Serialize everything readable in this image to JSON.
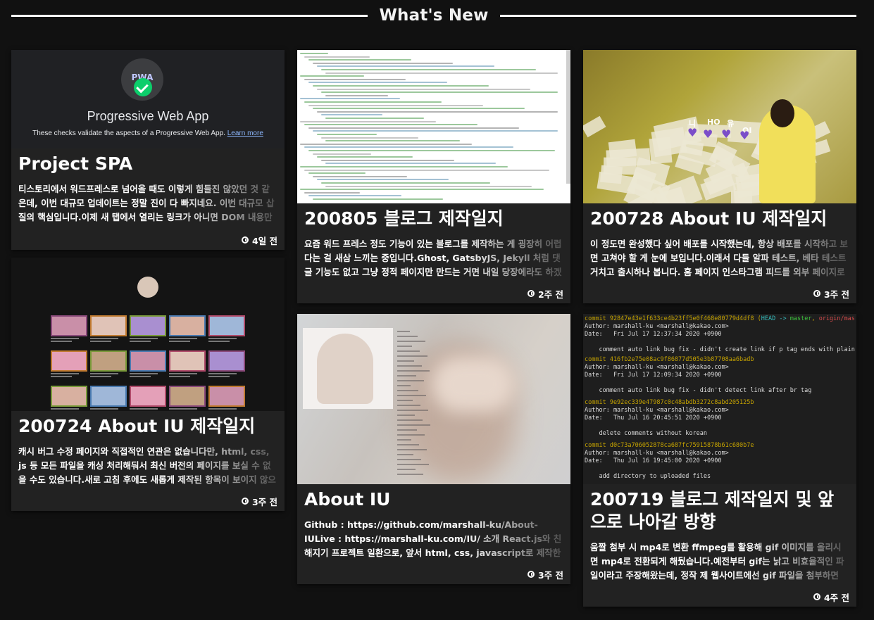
{
  "header": {
    "title": "What's New"
  },
  "posts": [
    {
      "title": "Project SPA",
      "excerpt": "티스토리에서 워드프레스로 넘어올 때도 이렇게 힘들진 않았던 것 같은데, 이번 대규모 업데이트는 정말 진이 다 빠지네요. 이번 대규모 삽질의 핵심입니다.이제 새 탭에서 열리는 링크가 아니면 DOM 내용만",
      "time": "4일 전",
      "thumb": {
        "badge": "PWA",
        "heading": "Progressive Web App",
        "desc": "These checks validate the aspects of a Progressive Web App.",
        "link": "Learn more"
      }
    },
    {
      "title": "200805 블로그 제작일지",
      "excerpt": "요즘 워드 프레스 정도 기능이 있는 블로그를 제작하는 게 굉장히 어렵다는 걸 새삼 느끼는 중입니다.Ghost, GatsbyJS, Jekyll 처럼 댓글 기능도 없고 그냥 정적 페이지만 만드는 거면 내일 당장에라도 하겠는데,",
      "time": "2주 전"
    },
    {
      "title": "200728 About IU 제작일지",
      "excerpt": "이 정도면 완성했다 싶어 배포를 시작했는데, 항상 배포를 시작하고 보면 고쳐야 할 게 눈에 보입니다.이래서 다들 알파 테스트, 베타 테스트 거치고 출시하나 봅니다. 홈 페이지 인스타그램 피드를 외부 페이지로",
      "time": "3주 전",
      "thumb": {
        "words": [
          "니",
          "HO",
          "유",
          "OI"
        ]
      }
    },
    {
      "title": "200724 About IU 제작일지",
      "excerpt": "캐시 버그 수정 페이지와 직접적인 연관은 없습니다만, html, css, js 등 모든 파일을 캐싱 처리해둬서 최신 버전의 페이지를 보실 수 없을 수도 있습니다.새로 고침 후에도 새롭게 제작된 항목이 보이지 않으신",
      "time": "3주 전"
    },
    {
      "title": "About IU",
      "excerpt": "Github : https://github.com/marshall-ku/About-IULive : https://marshall-ku.com/IU/ 소개 React.js와 친해지기 프로젝트 일환으로, 앞서 html, css, javascript로 제작한 트와이스 팬 페이지의 디자",
      "time": "3주 전"
    },
    {
      "title": "200719 블로그 제작일지 및 앞으로 나아갈 방향",
      "excerpt": "움짤 첨부 시 mp4로 변환 ffmpeg를 활용해 gif 이미지를 올리시면 mp4로 전환되게 해뒀습니다.예전부터 gif는 낡고 비효율적인 파일이라고 주장해왔는데, 정작 제 웹사이트에선 gif 파일을 첨부하면 gif 그",
      "time": "4주 전",
      "thumb": {
        "commits": [
          {
            "hash": "commit 92847e43e1f633ce4b23ff5e0f468e80779d4df8",
            "refs_open": " (",
            "head": "HEAD -> ",
            "master": "master",
            "sep": ", ",
            "origin": "origin/master",
            "refs_close": ")",
            "author": "Author: marshall-ku <marshall@kakao.com>",
            "date": "Date:   Fri Jul 17 12:37:34 2020 +0900",
            "msg": "    comment auto link bug fix - didn't create link if p tag ends with plain text"
          },
          {
            "hash": "commit 416fb2e75e08ac9f86877d505e3b87708aa6badb",
            "author": "Author: marshall-ku <marshall@kakao.com>",
            "date": "Date:   Fri Jul 17 12:09:34 2020 +0900",
            "msg": "    comment auto link bug fix - didn't detect link after br tag"
          },
          {
            "hash": "commit 9e92ec339e47987c0c48abdb3272c8abd205125b",
            "author": "Author: marshall-ku <marshall@kakao.com>",
            "date": "Date:   Thu Jul 16 20:45:51 2020 +0900",
            "msg": "    delete comments without korean"
          },
          {
            "hash": "commit d0c73a706052878ca687fc75915878b61c680b7e",
            "author": "Author: marshall-ku <marshall@kakao.com>",
            "date": "Date:   Thu Jul 16 19:45:00 2020 +0900",
            "msg": "    add directory to uploaded files"
          }
        ]
      }
    }
  ],
  "colors": {
    "background": "#111111",
    "card": "#222222",
    "text": "#ffffff",
    "pwa_green": "#0cce6b"
  },
  "icons": {
    "time": "clock-icon",
    "pwa": "check-circle-icon",
    "heart": "heart-icon"
  }
}
